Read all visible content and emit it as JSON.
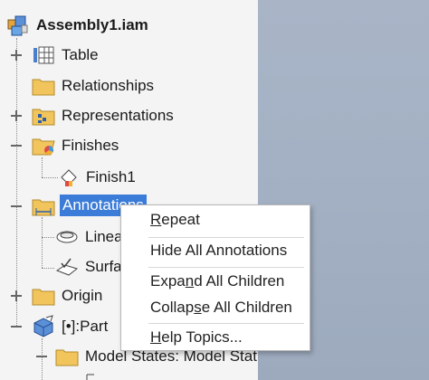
{
  "tree": {
    "root": {
      "label": "Assembly1.iam",
      "icon": "assembly-icon"
    },
    "items": {
      "table": {
        "label": "Table",
        "icon": "table-icon",
        "expander": "+"
      },
      "relationships": {
        "label": "Relationships",
        "icon": "folder-icon"
      },
      "representations": {
        "label": "Representations",
        "icon": "representations-folder-icon",
        "expander": "+"
      },
      "finishes": {
        "label": "Finishes",
        "icon": "finishes-folder-icon",
        "expander": "−"
      },
      "finish1": {
        "label": "Finish1",
        "icon": "finish-icon"
      },
      "annotations": {
        "label": "Annotations",
        "icon": "annotations-folder-icon",
        "expander": "−",
        "selected": true
      },
      "linear": {
        "label": "Linea",
        "icon": "linear-annotation-icon"
      },
      "surface": {
        "label": "Surfa",
        "icon": "surface-annotation-icon"
      },
      "origin": {
        "label": "Origin",
        "icon": "folder-icon",
        "expander": "+"
      },
      "part": {
        "label": "[•]:Part",
        "icon": "part-icon",
        "expander": "−"
      },
      "model_states": {
        "label": "Model States: Model Stat",
        "icon": "folder-icon",
        "expander": "−"
      }
    }
  },
  "context_menu": {
    "repeat": {
      "pre": "",
      "mnemonic": "R",
      "post": "epeat"
    },
    "hide_all": {
      "pre": "Hide All Annotations",
      "mnemonic": "",
      "post": ""
    },
    "expand_all": {
      "pre": "Expa",
      "mnemonic": "n",
      "post": "d All Children"
    },
    "collapse_all": {
      "pre": "Collap",
      "mnemonic": "s",
      "post": "e All Children"
    },
    "help": {
      "pre": "",
      "mnemonic": "H",
      "post": "elp Topics..."
    }
  },
  "colors": {
    "selection": "#3b7cd8",
    "folder": "#f2c55c",
    "viewport": "#a3b0c3"
  }
}
